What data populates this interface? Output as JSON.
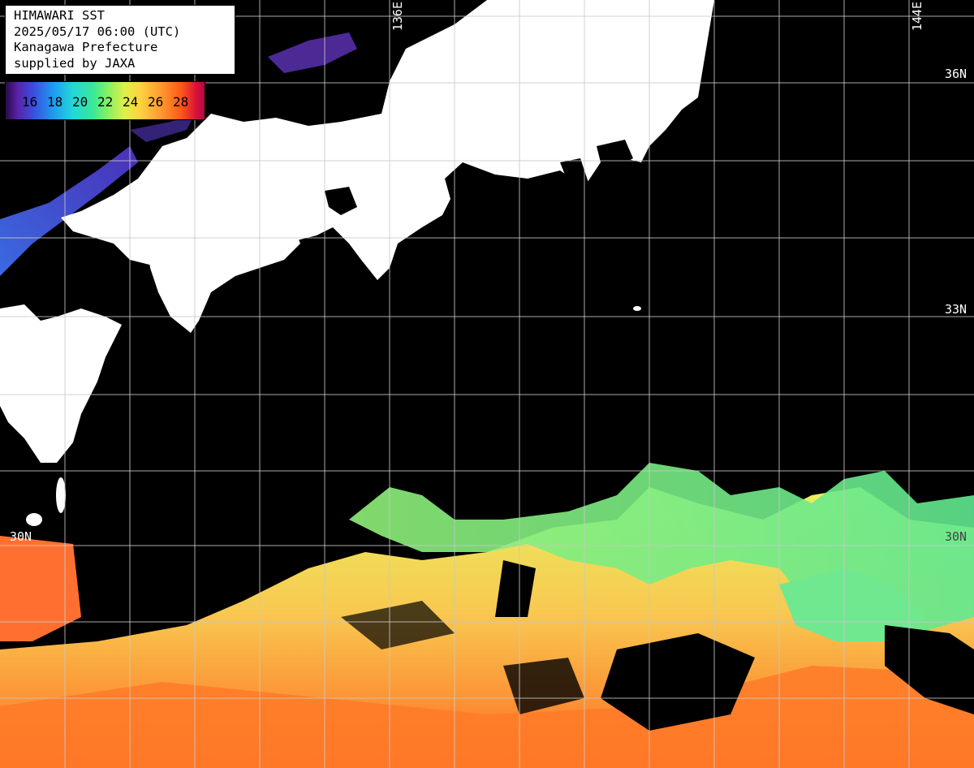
{
  "info": {
    "line1": "HIMAWARI SST",
    "line2": "2025/05/17 06:00 (UTC)",
    "line3": "Kanagawa Prefecture",
    "line4": "supplied by JAXA"
  },
  "legend": {
    "ticks": [
      "16",
      "18",
      "20",
      "22",
      "24",
      "26",
      "28"
    ],
    "unit_colors": [
      "#2a0a4a",
      "#3a4ee0",
      "#22d8d8",
      "#8ef060",
      "#ffd040",
      "#ff5a18",
      "#b00848"
    ]
  },
  "grid_labels": {
    "lon_136": "136E",
    "lon_144": "144E",
    "lat_36": "36N",
    "lat_33": "33N",
    "lat_30_left": "30N",
    "lat_30_right": "30N"
  },
  "colors": {
    "land": "#ffffff",
    "cloud": "#000000",
    "grid": "#c8c8c8",
    "cold_sea": "#3a4ee0",
    "cool_sea": "#8ef060",
    "warm_sea": "#f4e060",
    "hot_sea": "#ff6a20"
  }
}
